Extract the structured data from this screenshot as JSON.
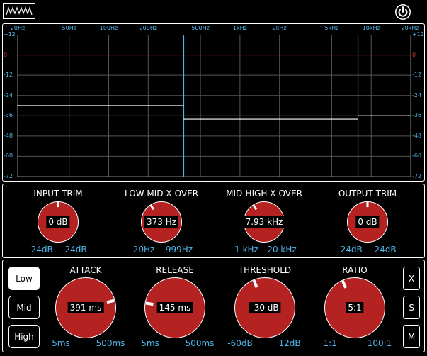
{
  "header": {
    "logo_icon": "waveform-logo-icon",
    "power_icon": "power-icon"
  },
  "graph": {
    "freq_labels": [
      "20Hz",
      "50Hz",
      "100Hz",
      "200Hz",
      "500Hz",
      "1kHz",
      "2kHz",
      "5kHz",
      "10kHz",
      "20kHz"
    ],
    "db_labels": [
      "+12",
      "0",
      "-12",
      "-24",
      "-36",
      "-48",
      "-60",
      "-72"
    ],
    "zero_db_color": "#d03030",
    "grid_color": "#555555",
    "crossover_color": "#4fb6ea",
    "band_levels_db": [
      -30,
      -38,
      -36
    ]
  },
  "trim_section": {
    "knobs": [
      {
        "label": "INPUT TRIM",
        "value": "0 dB",
        "min": "-24dB",
        "max": "24dB",
        "position": 0.5
      },
      {
        "label": "LOW-MID X-OVER",
        "value": "373 Hz",
        "min": "20Hz",
        "max": "999Hz",
        "position": 0.38
      },
      {
        "label": "MID-HIGH X-OVER",
        "value": "7.93 kHz",
        "min": "1 kHz",
        "max": "20 kHz",
        "position": 0.38
      },
      {
        "label": "OUTPUT TRIM",
        "value": "0 dB",
        "min": "-24dB",
        "max": "24dB",
        "position": 0.5
      }
    ]
  },
  "band_section": {
    "bands": [
      {
        "label": "Low",
        "active": true
      },
      {
        "label": "Mid",
        "active": false
      },
      {
        "label": "High",
        "active": false
      }
    ],
    "knobs": [
      {
        "label": "ATTACK",
        "value": "391 ms",
        "min": "5ms",
        "max": "500ms",
        "position": 0.78
      },
      {
        "label": "RELEASE",
        "value": "145 ms",
        "min": "5ms",
        "max": "500ms",
        "position": 0.2
      },
      {
        "label": "THRESHOLD",
        "value": "-30 dB",
        "min": "-60dB",
        "max": "12dB",
        "position": 0.42
      },
      {
        "label": "RATIO",
        "value": "5:1",
        "min": "1:1",
        "max": "100:1",
        "position": 0.41
      }
    ],
    "side_buttons": [
      "X",
      "S",
      "M"
    ],
    "knob_color": "#b52222"
  }
}
